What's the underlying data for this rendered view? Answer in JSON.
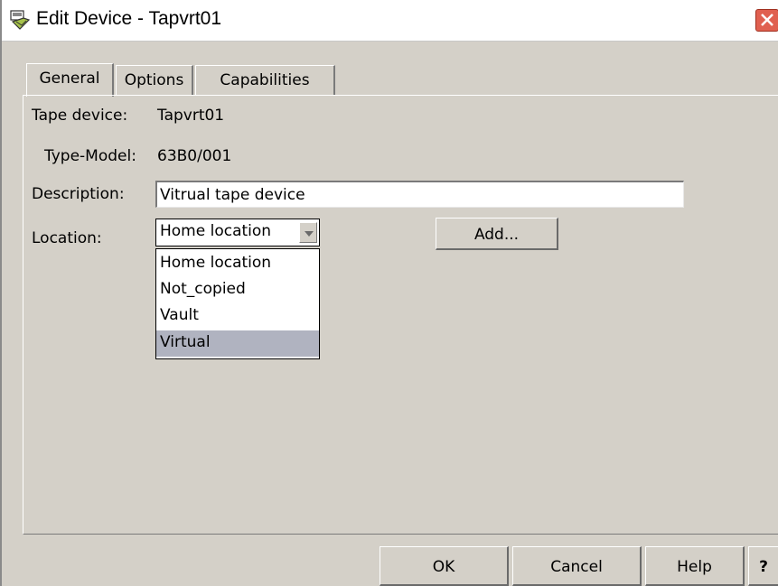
{
  "window": {
    "title": "Edit Device - Tapvrt01"
  },
  "tabs": [
    {
      "label": "General"
    },
    {
      "label": "Options"
    },
    {
      "label": "Capabilities"
    }
  ],
  "general": {
    "tape_device_label": "Tape device:",
    "tape_device_value": "Tapvrt01",
    "type_model_label": "Type-Model:",
    "type_model_value": "63B0/001",
    "description_label": "Description:",
    "description_value": "Vitrual tape device",
    "location_label": "Location:",
    "location_selected": "Home location",
    "location_options": [
      "Home location",
      "Not_copied",
      "Vault",
      "Virtual"
    ],
    "add_button": "Add..."
  },
  "footer": {
    "ok": "OK",
    "cancel": "Cancel",
    "help": "Help",
    "whats_this": "?"
  },
  "icons": {
    "window_icon": "tape-device-icon",
    "close": "close-icon",
    "dropdown_arrow": "chevron-down-icon"
  },
  "colors": {
    "dialog_bg": "#d4d0c8",
    "close_button": "#e06050",
    "highlight_option": "#b0b3c0"
  }
}
